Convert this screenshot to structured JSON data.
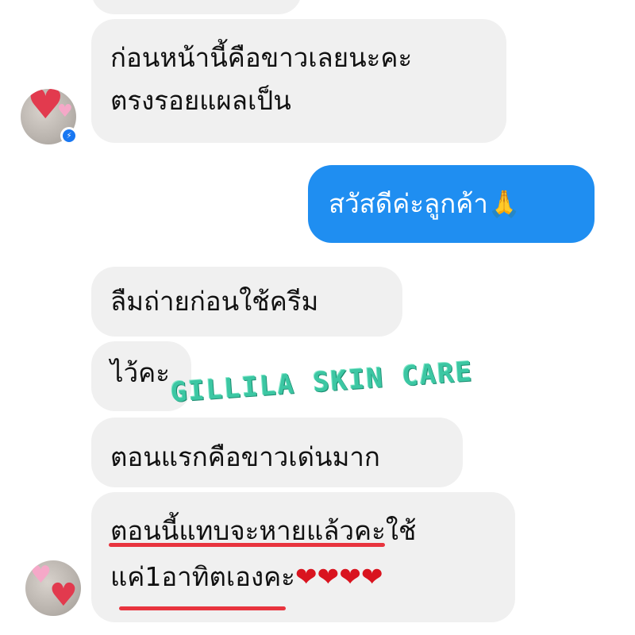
{
  "chat": {
    "messages": [
      {
        "direction": "incoming",
        "lines": [
          "ก่อนหน้านี้คือขาวเลยนะคะ",
          "ตรงรอยแผลเป็น"
        ]
      },
      {
        "direction": "outgoing",
        "lines": [
          "สวัสดีค่ะลูกค้า🙏"
        ]
      },
      {
        "direction": "incoming",
        "lines": [
          "ลืมถ่ายก่อนใช้ครีม"
        ]
      },
      {
        "direction": "incoming",
        "lines": [
          "ไว้คะ"
        ]
      },
      {
        "direction": "incoming",
        "lines": [
          "ตอนแรกคือขาวเด่นมาก"
        ]
      },
      {
        "direction": "incoming",
        "lines": [
          "ตอนนี้แทบจะหายแล้วคะใช้",
          "แค่1อาทิตเองคะ"
        ],
        "trailing_emoji": "❤❤❤❤"
      }
    ]
  },
  "watermark": "GILLILA SKIN CARE",
  "colors": {
    "incoming_bubble": "#f0f0f0",
    "outgoing_bubble": "#1f8ef1",
    "underline": "#e8343e",
    "watermark": "#3cc7a3"
  },
  "icons": [
    "heart-icon",
    "messenger-icon"
  ]
}
